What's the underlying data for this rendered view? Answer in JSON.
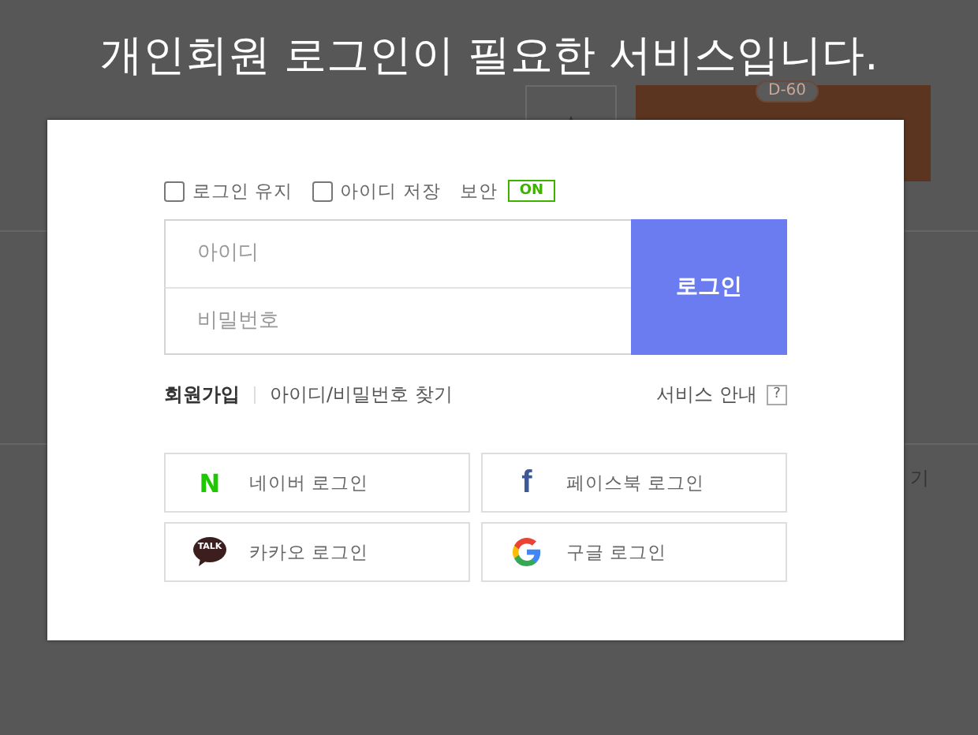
{
  "page_title": "개인회원 로그인이 필요한 서비스입니다.",
  "background": {
    "badge": "D-60",
    "side_text": "기"
  },
  "login": {
    "options": [
      {
        "kind": "checkbox",
        "label": "로그인 유지",
        "checked": false
      },
      {
        "kind": "checkbox",
        "label": "아이디 저장",
        "checked": false
      },
      {
        "kind": "toggle",
        "label": "보안",
        "on": true,
        "state_text": "ON"
      }
    ],
    "id_field": {
      "placeholder": "아이디"
    },
    "password_field": {
      "placeholder": "비밀번호"
    },
    "submit": "로그인",
    "links": [
      "회원가입",
      "아이디/비밀번호 찾기"
    ],
    "help": {
      "label": "서비스 안내",
      "icon": "?"
    },
    "social": [
      {
        "kind": "naver",
        "label": "네이버 로그인",
        "icon_text": "N"
      },
      {
        "kind": "facebook",
        "label": "페이스북 로그인",
        "icon_text": "f"
      },
      {
        "kind": "kakao",
        "label": "카카오 로그인",
        "icon_text": "TALK"
      },
      {
        "kind": "google",
        "label": "구글 로그인"
      }
    ]
  }
}
